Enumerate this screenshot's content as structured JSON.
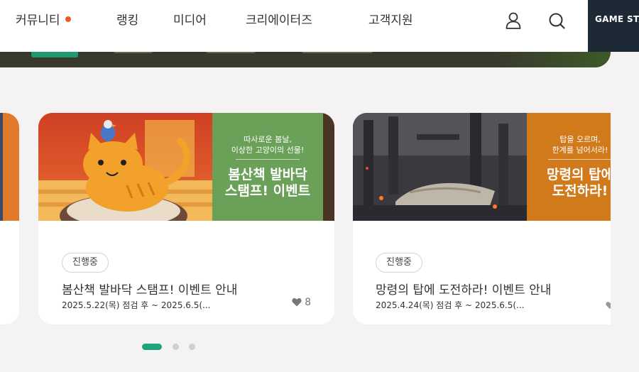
{
  "nav": {
    "items": [
      {
        "label": "커뮤니티",
        "has_dot": true
      },
      {
        "label": "랭킹"
      },
      {
        "label": "미디어"
      },
      {
        "label": "크리에이터즈"
      },
      {
        "label": "고객지원"
      }
    ],
    "icons": [
      "user-icon",
      "search-icon"
    ],
    "partner_label": "GAME STA"
  },
  "cards": [
    {
      "status": "진행중",
      "title": "봄산책 발바닥 스탬프! 이벤트 안내",
      "date": "2025.5.22(목) 점검 후 ~ 2025.6.5(...",
      "likes": "8",
      "banner": {
        "sub_line1": "따사로운 봄날,",
        "sub_line2": "이상한 고양이의 선물!",
        "main_line1": "봄산책 발바닥",
        "main_line2": "스탬프! 이벤트"
      }
    },
    {
      "status": "진행중",
      "title": "망령의 탑에 도전하라! 이벤트 안내",
      "date": "2025.4.24(목) 점검 후 ~ 2025.6.5(...",
      "banner": {
        "sub_line1": "탑을 오르며,",
        "sub_line2": "한계를 넘어서라!",
        "main_line1": "망령의 탑에",
        "main_line2": "도전하라!"
      }
    }
  ],
  "pagination": {
    "total": 3,
    "active": 1
  },
  "colors": {
    "accent": "#1ea47a",
    "dot": "#ee5a24",
    "banner1_panel": "#6aa058",
    "banner2_panel": "#d07a1c"
  }
}
